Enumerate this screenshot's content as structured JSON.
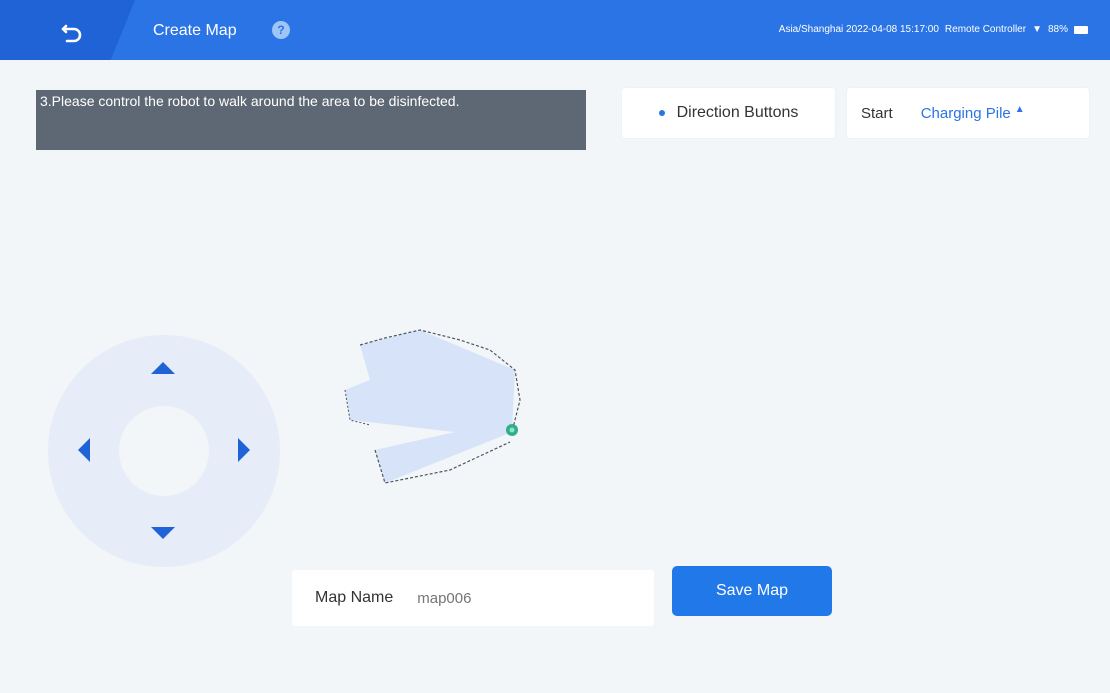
{
  "header": {
    "title": "Create Map",
    "help_icon": "?",
    "timezone_datetime": "Asia/Shanghai 2022-04-08 15:17:00",
    "control_mode": "Remote Controller",
    "battery": "88%",
    "bg_color": "#2b74e6"
  },
  "instruction": {
    "text": "3.Please control the robot to walk around the area to be disinfected."
  },
  "direction_card": {
    "label": "Direction Buttons"
  },
  "start_card": {
    "label": "Start",
    "value": "Charging Pile",
    "caret": "▲"
  },
  "joystick": {
    "up_icon": "arrow-up",
    "down_icon": "arrow-down",
    "left_icon": "arrow-left",
    "right_icon": "arrow-right"
  },
  "map_name": {
    "label": "Map Name",
    "placeholder": "map006"
  },
  "save_button": {
    "label": "Save Map"
  }
}
